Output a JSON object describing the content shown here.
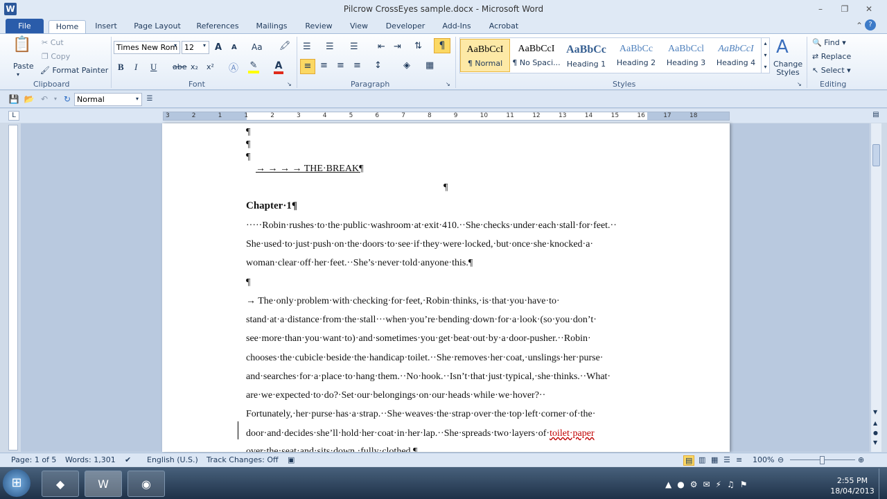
{
  "window": {
    "title": "Pilcrow CrossEyes sample.docx - Microsoft Word",
    "app_icon": "W"
  },
  "tabs": [
    "File",
    "Home",
    "Insert",
    "Page Layout",
    "References",
    "Mailings",
    "Review",
    "View",
    "Developer",
    "Add-Ins",
    "Acrobat"
  ],
  "clipboard": {
    "paste": "Paste",
    "cut": "Cut",
    "copy": "Copy",
    "format_painter": "Format Painter",
    "label": "Clipboard"
  },
  "font": {
    "name": "Times New Rom",
    "size": "12",
    "label": "Font",
    "bold": "B",
    "italic": "I",
    "underline": "U",
    "strike": "abe",
    "sub": "x₂",
    "sup": "x²",
    "grow": "A",
    "shrink": "A",
    "case": "Aa",
    "font_color": "A"
  },
  "paragraph": {
    "label": "Paragraph",
    "pilcrow": "¶"
  },
  "styles": {
    "label": "Styles",
    "items": [
      {
        "sample": "AaBbCcI",
        "name": "¶ Normal"
      },
      {
        "sample": "AaBbCcI",
        "name": "¶ No Spaci..."
      },
      {
        "sample": "AaBbCc",
        "name": "Heading 1"
      },
      {
        "sample": "AaBbCc",
        "name": "Heading 2"
      },
      {
        "sample": "AaBbCcl",
        "name": "Heading 3"
      },
      {
        "sample": "AaBbCcI",
        "name": "Heading 4"
      }
    ],
    "change_styles": "Change Styles"
  },
  "editing": {
    "find": "Find",
    "replace": "Replace",
    "select": "Select",
    "label": "Editing"
  },
  "qat": {
    "style_box": "Normal"
  },
  "ruler_numbers": [
    "3",
    "2",
    "1",
    "1",
    "2",
    "3",
    "4",
    "5",
    "6",
    "7",
    "8",
    "9",
    "10",
    "11",
    "12",
    "13",
    "14",
    "15",
    "16",
    "17",
    "18"
  ],
  "document": {
    "lines": [
      "¶",
      "¶",
      "¶",
      "→        →        →        →        THE·BREAK¶",
      "¶",
      "Chapter·1¶",
      "·····Robin·rushes·to·the·public·washroom·at·exit·410.··She·checks·under·each·stall·for·feet.··",
      "She·used·to·just·push·on·the·doors·to·see·if·they·were·locked,·but·once·she·knocked·a·",
      "woman·clear·off·her·feet.··She’s·never·told·anyone·this.¶",
      "¶",
      "    →    The·only·problem·with·checking·for·feet,·Robin·thinks,·is·that·you·have·to·",
      "stand·at·a·distance·from·the·stall···when·you’re·bending·down·for·a·look·(so·you·don’t·",
      "see·more·than·you·want·to)·and·sometimes·you·get·beat·out·by·a·door-pusher.··Robin·",
      "chooses·the·cubicle·beside·the·handicap·toilet.··She·removes·her·coat,·unslings·her·purse·",
      "and·searches·for·a·place·to·hang·them.··No·hook.··Isn’t·that·just·typical,·she·thinks.··What·",
      "are·we·expected·to·do?·Set·our·belongings·on·our·heads·while·we·hover?··",
      "Fortunately,·her·purse·has·a·strap.··She·weaves·the·strap·over·the·top·left·corner·of·the·",
      "door·and·decides·she’ll·hold·her·coat·in·her·lap.··She·spreads·two·layers·of·",
      "over·the·seat·and·sits·down,·fully·clothed.¶"
    ],
    "misspelled": "toilet·paper"
  },
  "status": {
    "page": "Page: 1 of 5",
    "words": "Words: 1,301",
    "language": "English (U.S.)",
    "track": "Track Changes: Off",
    "zoom": "100%"
  },
  "clock": {
    "time": "2:55 PM",
    "date": "18/04/2013"
  },
  "colors": {
    "accent": "#2a5caa",
    "misspelled": "#c00000"
  }
}
